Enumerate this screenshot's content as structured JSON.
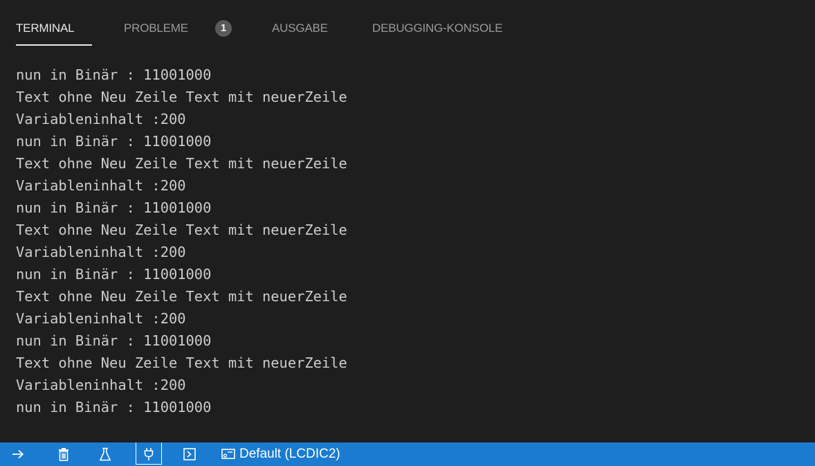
{
  "tabs": [
    {
      "label": "TERMINAL",
      "active": true
    },
    {
      "label": "PROBLEME",
      "badge": "1"
    },
    {
      "label": "AUSGABE"
    },
    {
      "label": "DEBUGGING-KONSOLE"
    }
  ],
  "terminal": {
    "lines": [
      "nun in Binär : 11001000",
      "Text ohne Neu Zeile Text mit neuerZeile",
      "Variableninhalt :200",
      "nun in Binär : 11001000",
      "Text ohne Neu Zeile Text mit neuerZeile",
      "Variableninhalt :200",
      "nun in Binär : 11001000",
      "Text ohne Neu Zeile Text mit neuerZeile",
      "Variableninhalt :200",
      "nun in Binär : 11001000",
      "Text ohne Neu Zeile Text mit neuerZeile",
      "Variableninhalt :200",
      "nun in Binär : 11001000",
      "Text ohne Neu Zeile Text mit neuerZeile",
      "Variableninhalt :200",
      "nun in Binär : 11001000"
    ]
  },
  "statusbar": {
    "icons": [
      "arrow-right-icon",
      "trash-icon",
      "flask-icon",
      "plug-icon",
      "terminal-icon",
      "device-icon"
    ],
    "device_label": "Default (LCDIC2)",
    "background_color": "#1a7bd0"
  },
  "colors": {
    "background": "#1e1e1e",
    "text": "#cccccc",
    "tab_inactive": "#9a9a9a",
    "tab_active": "#e8e8e8"
  }
}
